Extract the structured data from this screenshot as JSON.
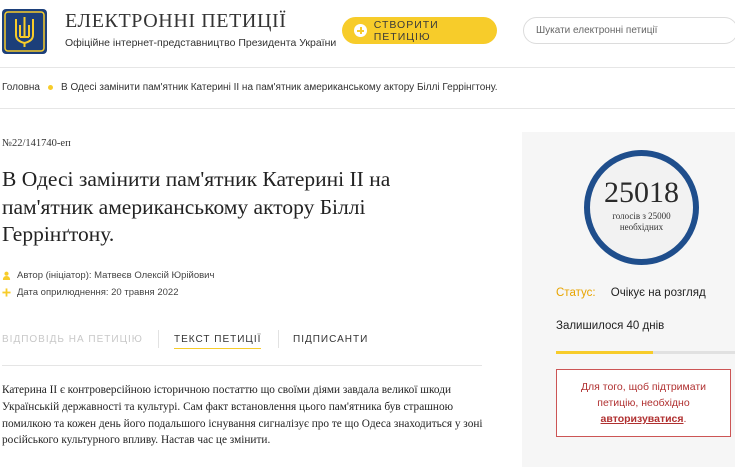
{
  "header": {
    "title": "ЕЛЕКТРОННІ ПЕТИЦІЇ",
    "subtitle": "Офіційне інтернет-представництво Президента України",
    "create_label": "СТВОРИТИ ПЕТИЦІЮ",
    "search_placeholder": "Шукати електронні петиції"
  },
  "breadcrumb": {
    "home": "Головна",
    "current": "В Одесі замінити пам'ятник Катерині ІІ на пам'ятник американському актору Біллі Геррінгтону."
  },
  "petition": {
    "number": "№22/141740-еп",
    "title": "В Одесі замінити пам'ятник Катерині ІІ на пам'ятник американському актору Біллі Геррінґтону.",
    "author": "Автор (ініціатор): Матвеєв Олексій Юрійович",
    "published": "Дата оприлюднення: 20 травня 2022",
    "body": "Катерина ІІ є контроверсійною історичною постаттю що своїми діями завдала великої шкоди Українській державності та культурі. Сам факт встановлення цього пам'ятника був страшною помилкою та кожен день його подальшого існування сигналізує про те що Одеса знаходиться у зоні російського культурного впливу. Настав час це змінити."
  },
  "tabs": {
    "respond": "ВІДПОВІДЬ НА ПЕТИЦІЮ",
    "text": "ТЕКСТ ПЕТИЦІЇ",
    "signers": "ПІДПИСАНТИ"
  },
  "sidebar": {
    "votes": "25018",
    "votes_label_line1": "голосів з 25000",
    "votes_label_line2": "необхідних",
    "status_key": "Статус:",
    "status_value": "Очікує на розгляд",
    "remaining": "Залишилося 40 днів",
    "days_progress_fraction": 0.54,
    "auth_line1": "Для того, щоб підтримати",
    "auth_line2": "петицію, необхідно",
    "auth_link": "авторизуватися",
    "auth_end": "."
  },
  "colors": {
    "accent": "#f7cc2a",
    "brand_blue": "#1f4e8c",
    "status_orange": "#e8a400",
    "alert_red": "#b03030"
  },
  "icons": {
    "logo": "trident-coat-of-arms-icon",
    "create": "plus-icon",
    "author": "person-icon",
    "date": "plus-small-icon"
  }
}
